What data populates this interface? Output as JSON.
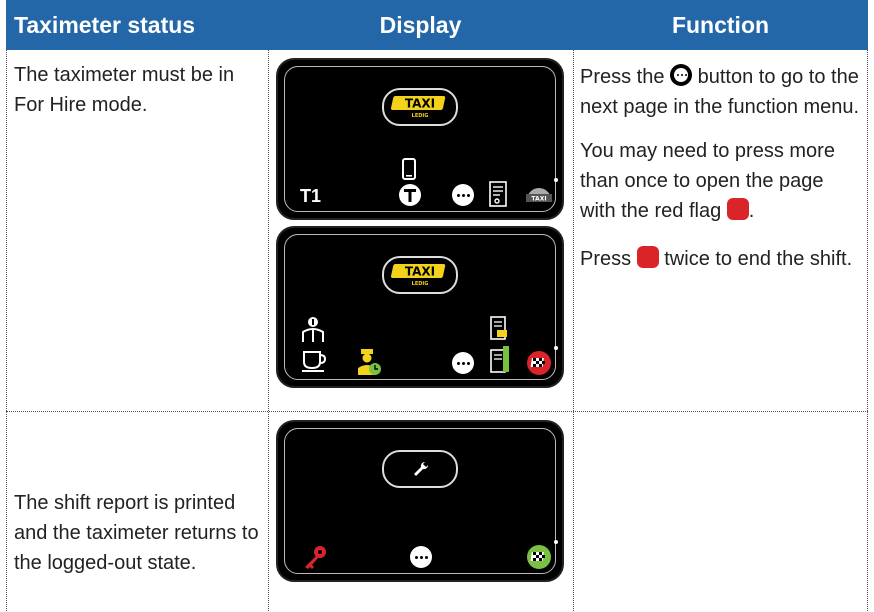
{
  "headers": {
    "status": "Taximeter status",
    "display": "Display",
    "function": "Function"
  },
  "row1": {
    "status": "The taximeter must be in For Hire mode.",
    "func_p1_a": "Press the",
    "func_p1_b": "button to go to the next page in the function menu.",
    "func_p2_a": "You may need to press more than once to open the page with the red flag",
    "func_p2_b": ".",
    "func_p3_a": "Press",
    "func_p3_b": "twice to end the shift.",
    "display_top_badge_main": "TAXI",
    "display_top_badge_sub": "LEDIG",
    "display_top_t1": "T1",
    "display_bottom_badge_main": "TAXI",
    "display_bottom_badge_sub": "LEDIG"
  },
  "row2": {
    "status": "The shift report is printed and the taximeter returns to the logged-out state."
  },
  "colors": {
    "header_bg": "#2467a8",
    "badge_yellow": "#f2d21a",
    "flag_red": "#d9252a",
    "flag_green": "#7ac142",
    "key_red": "#d9252a"
  }
}
